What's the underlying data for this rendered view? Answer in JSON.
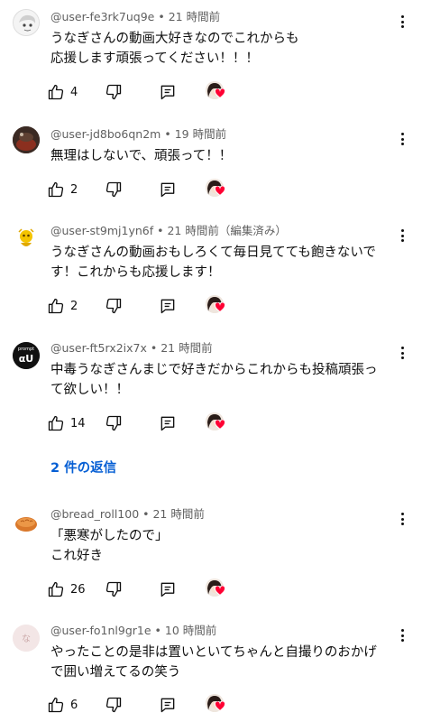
{
  "comments": [
    {
      "username": "@user-fe3rk7uq9e",
      "time": "21 時間前",
      "edited": "",
      "lines": [
        "うなぎさんの動画大好きなのでこれからも",
        "応援します頑張ってください！！！"
      ],
      "likes": "4"
    },
    {
      "username": "@user-jd8bo6qn2m",
      "time": "19 時間前",
      "edited": "",
      "lines": [
        "無理はしないで、頑張って！！"
      ],
      "likes": "2"
    },
    {
      "username": "@user-st9mj1yn6f",
      "time": "21 時間前",
      "edited": "（編集済み）",
      "lines": [
        "うなぎさんの動画おもしろくて毎日見てても飽きないで",
        "す！これからも応援します！"
      ],
      "likes": "2"
    },
    {
      "username": "@user-ft5rx2ix7x",
      "time": "21 時間前",
      "edited": "",
      "lines": [
        "中毒うなぎさんまじで好きだからこれからも投稿頑張っ",
        "て欲しい！！"
      ],
      "likes": "14",
      "avatar_text": "αU",
      "avatar_top": "prompt"
    },
    {
      "username": "@bread_roll100",
      "time": "21 時間前",
      "edited": "",
      "lines": [
        "「悪寒がしたので」",
        "これ好き"
      ],
      "likes": "26"
    },
    {
      "username": "@user-fo1nl9gr1e",
      "time": "10 時間前",
      "edited": "",
      "lines": [
        "やったことの是非は置いといてちゃんと自撮りのおかげ",
        "で囲い増えてるの笑う"
      ],
      "likes": "6",
      "avatar_text": "な"
    }
  ],
  "replies_link": "2 件の返信",
  "colors": {
    "link": "#065fd4",
    "heart": "#ff0033",
    "meta": "#606060"
  },
  "icons": [
    "thumb-up-icon",
    "thumb-down-icon",
    "reply-icon",
    "creator-heart-icon",
    "more-vert-icon"
  ]
}
